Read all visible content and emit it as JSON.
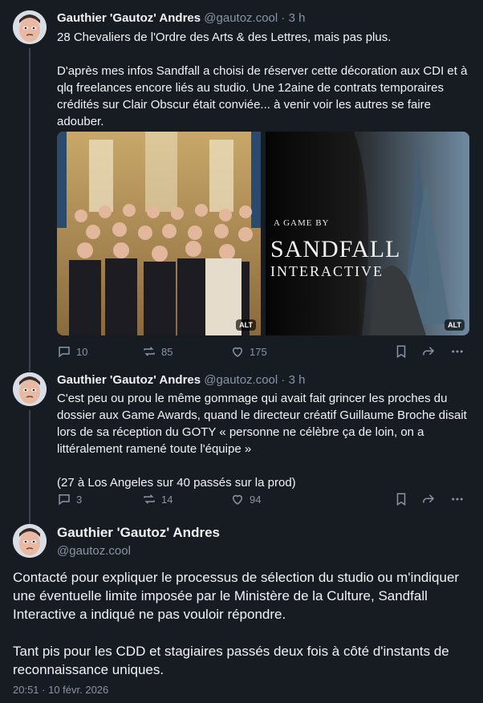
{
  "posts": [
    {
      "author": "Gauthier 'Gautoz' Andres",
      "handle": "@gautoz.cool",
      "separator": "·",
      "time": "3 h",
      "text": "28 Chevaliers de l'Ordre des Arts & des Lettres, mais pas plus.\n\nD'après mes infos Sandfall a choisi de réserver cette décoration aux CDI et à qlq freelances encore liés au studio. Une 12aine de contrats temporaires crédités sur Clair Obscur était conviée... à venir voir les autres se faire adouber.",
      "media": [
        {
          "alt_badge": "ALT",
          "description": "group-photo"
        },
        {
          "alt_badge": "ALT",
          "caption_small": "A GAME BY",
          "caption_big_1": "SANDFALL",
          "caption_big_2": "INTERACTIVE"
        }
      ],
      "replies": "10",
      "reposts": "85",
      "likes": "175"
    },
    {
      "author": "Gauthier 'Gautoz' Andres",
      "handle": "@gautoz.cool",
      "separator": "·",
      "time": "3 h",
      "text": "C'est peu ou prou le même gommage qui avait fait grincer les proches du dossier aux Game Awards, quand le directeur créatif Guillaume Broche disait lors de sa réception du GOTY « personne ne célèbre ça de loin, on a littéralement ramené toute l'équipe »\n\n(27 à Los Angeles sur 40 passés sur la prod)",
      "replies": "3",
      "reposts": "14",
      "likes": "94"
    }
  ],
  "main_post": {
    "author": "Gauthier 'Gautoz' Andres",
    "handle": "@gautoz.cool",
    "text": "Contacté pour expliquer le processus de sélection du studio ou m'indiquer une éventuelle limite imposée par le Ministère de la Culture, Sandfall Interactive a indiqué ne pas vouloir répondre.\n\nTant pis pour les CDD et stagiaires passés deux fois à côté d'instants de reconnaissance uniques.",
    "date": "20:51 · 10 févr. 2026"
  },
  "colors": {
    "background": "#171b22",
    "muted": "#8a94a6",
    "text": "#f1f3f5"
  },
  "icons": [
    "reply-icon",
    "repost-icon",
    "like-icon",
    "bookmark-icon",
    "share-icon",
    "more-icon"
  ]
}
